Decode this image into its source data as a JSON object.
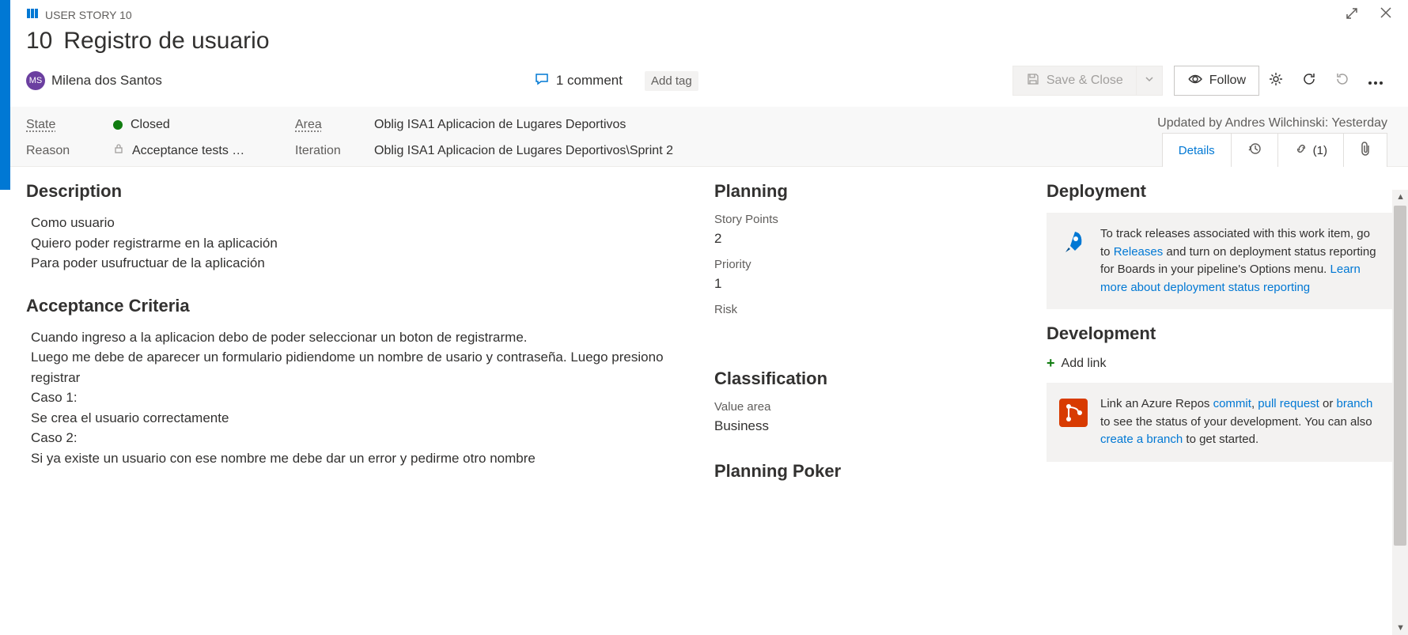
{
  "header": {
    "type_label": "USER STORY 10",
    "id": "10",
    "title": "Registro de usuario",
    "user_initials": "MS",
    "user_name": "Milena dos Santos",
    "comment_count": "1 comment",
    "add_tag": "Add tag"
  },
  "toolbar": {
    "save_close": "Save & Close",
    "follow": "Follow"
  },
  "meta": {
    "state_label": "State",
    "state_value": "Closed",
    "reason_label": "Reason",
    "reason_value": "Acceptance tests …",
    "area_label": "Area",
    "area_value": "Oblig ISA1 Aplicacion de Lugares Deportivos",
    "iteration_label": "Iteration",
    "iteration_value": "Oblig ISA1 Aplicacion de Lugares Deportivos\\Sprint 2",
    "updated_by": "Updated by Andres Wilchinski: Yesterday"
  },
  "tabs": {
    "details": "Details",
    "links_count": "(1)"
  },
  "description": {
    "heading": "Description",
    "line1": "Como usuario",
    "line2": "Quiero poder registrarme en la aplicación",
    "line3": "Para poder usufructuar de la aplicación"
  },
  "acceptance": {
    "heading": "Acceptance Criteria",
    "line1": "Cuando ingreso a la aplicacion debo de poder seleccionar un boton de registrarme.",
    "line2": "Luego me debe de aparecer un formulario pidiendome un nombre de usario y contraseña. Luego presiono registrar",
    "line3": "Caso 1:",
    "line4": "Se crea el usuario correctamente",
    "line5": "Caso 2:",
    "line6": "Si ya existe un usuario con ese nombre me debe dar un error y pedirme otro nombre"
  },
  "planning": {
    "heading": "Planning",
    "story_points_label": "Story Points",
    "story_points_value": "2",
    "priority_label": "Priority",
    "priority_value": "1",
    "risk_label": "Risk"
  },
  "classification": {
    "heading": "Classification",
    "value_area_label": "Value area",
    "value_area_value": "Business"
  },
  "planning_poker": {
    "heading": "Planning Poker"
  },
  "deployment": {
    "heading": "Deployment",
    "text_pre": "To track releases associated with this work item, go to ",
    "releases_link": "Releases",
    "text_mid": " and turn on deployment status reporting for Boards in your pipeline's Options menu. ",
    "learn_link": "Learn more about deployment status reporting"
  },
  "development": {
    "heading": "Development",
    "add_link": "Add link",
    "text_pre": "Link an Azure Repos ",
    "commit_link": "commit",
    "sep1": ", ",
    "pr_link": "pull request",
    "sep2": " or ",
    "branch_link": "branch",
    "text_mid": " to see the status of your development. You can also ",
    "create_link": "create a branch",
    "text_post": " to get started."
  }
}
